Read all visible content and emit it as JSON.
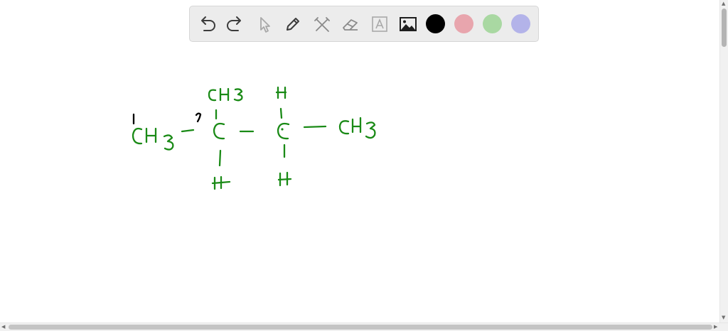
{
  "toolbar": {
    "tools": [
      {
        "name": "undo-icon"
      },
      {
        "name": "redo-icon"
      },
      {
        "name": "select-pointer-icon"
      },
      {
        "name": "pen-icon"
      },
      {
        "name": "tools-icon"
      },
      {
        "name": "eraser-icon"
      },
      {
        "name": "text-box-icon"
      },
      {
        "name": "image-icon"
      }
    ],
    "colors": [
      "#000000",
      "#e8a5ad",
      "#a9d8a2",
      "#b3b3e9"
    ],
    "selected_color": "#000000"
  },
  "drawing": {
    "ink_color": "#1a8a16",
    "annotation_color": "#000000",
    "handwritten_labels": [
      "1",
      "CH3",
      "2",
      "CH3",
      "H",
      "C",
      "C",
      "CH3",
      "H",
      "H"
    ]
  },
  "scrollbars": {
    "vertical": "scrollbar",
    "horizontal": "scrollbar"
  }
}
